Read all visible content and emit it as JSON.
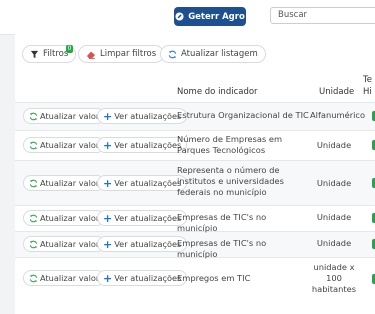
{
  "header": {
    "action_label": "Geterr Agro",
    "search_placeholder": "Buscar"
  },
  "toolbar": {
    "filters_label": "Filtros",
    "filters_count": "0",
    "clear_label": "Limpar filtros",
    "refresh_label": "Atualizar listagem"
  },
  "table": {
    "headers": {
      "indicator": "Nome do indicador",
      "unit": "Unidade",
      "next_top": "Te",
      "next_bottom": "Hi"
    },
    "update_label": "Atualizar valor",
    "view_label": "Ver atualizações",
    "rows": [
      {
        "indicator": "Estrutura Organizacional de TIC",
        "unit": "Alfanumérico"
      },
      {
        "indicator": "Número de Empresas em Parques Tecnológicos",
        "unit": "Unidade"
      },
      {
        "indicator": "Representa o número de institutos e universidades federais no município",
        "unit": "Unidade"
      },
      {
        "indicator": "Empresas de TIC's no município",
        "unit": "Unidade"
      },
      {
        "indicator": "Empresas de TIC's no município",
        "unit": "Unidade"
      },
      {
        "indicator": "Empregos em TIC",
        "unit": "unidade x 100 habitantes"
      }
    ]
  },
  "colors": {
    "primary": "#1d4f91",
    "accent": "#28a745",
    "link": "#1a73e8"
  }
}
